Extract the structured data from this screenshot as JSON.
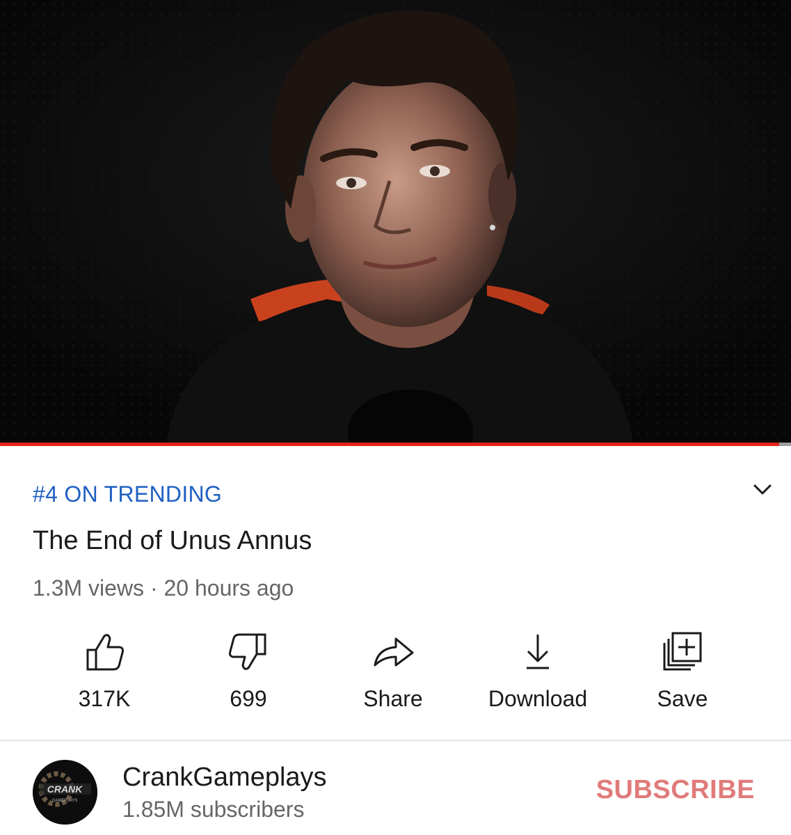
{
  "video": {
    "progress_percent": 98.5,
    "trending_label": "#4 ON TRENDING",
    "title": "The End of Unus Annus",
    "views": "1.3M views",
    "separator": "·",
    "uploaded": "20 hours ago"
  },
  "actions": [
    {
      "name": "like",
      "label": "317K",
      "icon": "thumbs-up-icon"
    },
    {
      "name": "dislike",
      "label": "699",
      "icon": "thumbs-down-icon"
    },
    {
      "name": "share",
      "label": "Share",
      "icon": "share-arrow-icon"
    },
    {
      "name": "download",
      "label": "Download",
      "icon": "download-icon"
    },
    {
      "name": "save",
      "label": "Save",
      "icon": "add-to-playlist-icon"
    }
  ],
  "channel": {
    "name": "CrankGameplays",
    "subscribers": "1.85M subscribers",
    "avatar_text": "CRANK",
    "avatar_subtext": "GAMEPLAYS",
    "subscribe_label": "SUBSCRIBE"
  },
  "colors": {
    "trending": "#1f5fc2",
    "subscribe": "#e07b7b",
    "progress": "#e62117",
    "player_bg": "#0c0c0c"
  }
}
